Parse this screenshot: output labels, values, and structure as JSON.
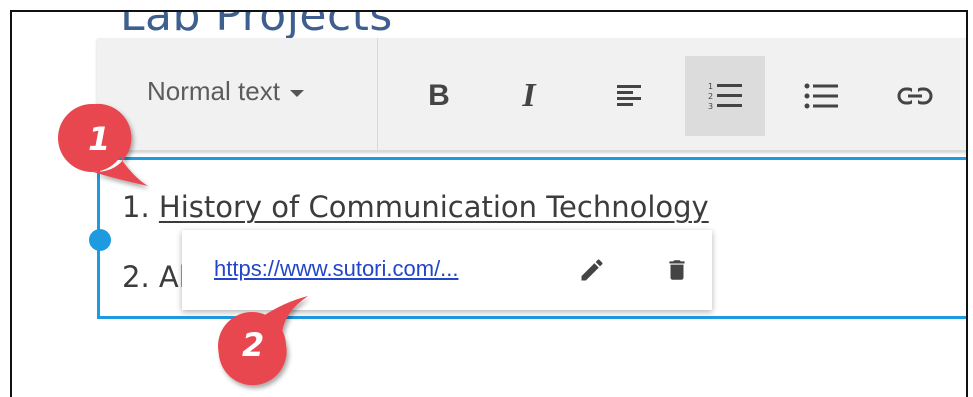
{
  "page": {
    "title": "Lab Projects"
  },
  "toolbar": {
    "style_select": {
      "value": "Normal text"
    },
    "buttons": {
      "bold": {
        "glyph": "B",
        "icon": "bold-icon"
      },
      "italic": {
        "glyph": "I",
        "icon": "italic-icon"
      },
      "align_left": {
        "icon": "align-left-icon"
      },
      "numbered_list": {
        "icon": "numbered-list-icon",
        "active": true
      },
      "bulleted_list": {
        "icon": "bulleted-list-icon"
      },
      "link": {
        "icon": "link-icon"
      }
    }
  },
  "editor": {
    "items": [
      {
        "number": "1.",
        "text": "History of Communication Technology"
      },
      {
        "number": "2.",
        "text": "Al"
      }
    ]
  },
  "link_popup": {
    "url": "https://www.sutori.com/...",
    "edit_icon": "pencil-icon",
    "delete_icon": "trash-icon"
  },
  "callouts": [
    {
      "label": "1"
    },
    {
      "label": "2"
    }
  ],
  "colors": {
    "accent": "#1e9ae0",
    "callout": "#e8474f",
    "link": "#2346c8",
    "title": "#3f5f8f"
  }
}
